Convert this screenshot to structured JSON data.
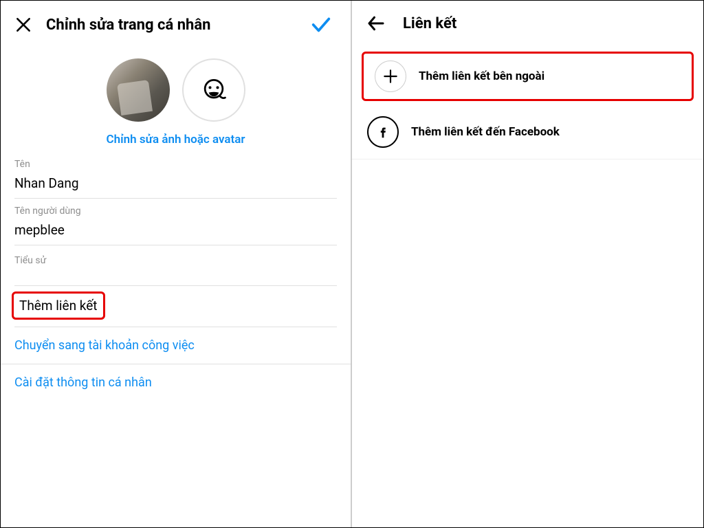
{
  "left": {
    "header": {
      "title": "Chỉnh sửa trang cá nhân"
    },
    "editPhoto": "Chỉnh sửa ảnh hoặc avatar",
    "fields": {
      "name": {
        "label": "Tên",
        "value": "Nhan Dang"
      },
      "username": {
        "label": "Tên người dùng",
        "value": "mepblee"
      },
      "bio": {
        "label": "Tiểu sử"
      }
    },
    "addLink": "Thêm liên kết",
    "switchAccount": "Chuyển sang tài khoản công việc",
    "personalInfo": "Cài đặt thông tin cá nhân"
  },
  "right": {
    "header": {
      "title": "Liên kết"
    },
    "options": {
      "external": "Thêm liên kết bên ngoài",
      "facebook": "Thêm liên kết đến Facebook"
    }
  }
}
